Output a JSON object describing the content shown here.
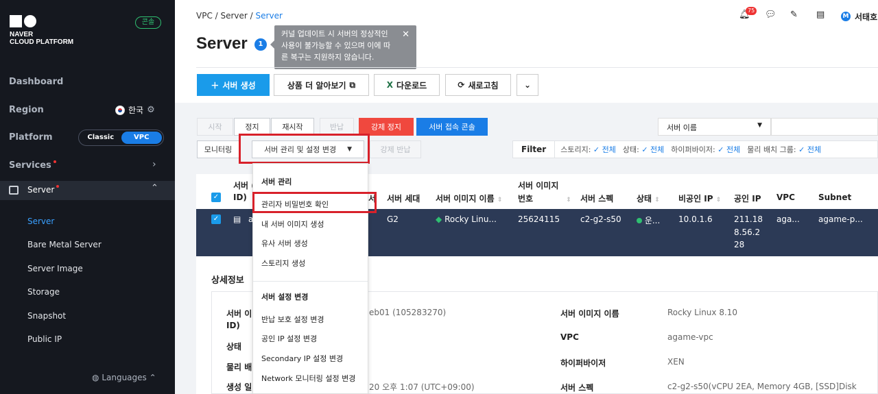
{
  "sidebar": {
    "brand_line1": "NAVER",
    "brand_line2": "CLOUD PLATFORM",
    "console": "콘솔",
    "dashboard": "Dashboard",
    "region_label": "Region",
    "region_value": "한국",
    "platform_label": "Platform",
    "classic": "Classic",
    "vpc": "VPC",
    "services": "Services",
    "server": "Server",
    "sub": [
      "Server",
      "Bare Metal Server",
      "Server Image",
      "Storage",
      "Snapshot",
      "Public IP"
    ],
    "languages": "Languages"
  },
  "header": {
    "breadcrumb": [
      "VPC",
      "Server",
      "Server"
    ],
    "notif_count": "75",
    "user": "서태호",
    "title": "Server",
    "title_badge": "1",
    "tooltip": "커널 업데이트 시 서버의 정상적인 사용이 불가능할 수 있으며 이에 따른 복구는 지원하지 않습니다."
  },
  "toolbar": {
    "create": "서버 생성",
    "more": "상품 더 알아보기",
    "download": "다운로드",
    "refresh": "새로고침"
  },
  "actions": {
    "start": "시작",
    "stop": "정지",
    "restart": "재시작",
    "return": "반납",
    "force_stop": "강제 정지",
    "console_access": "서버 접속 콘솔",
    "monitoring": "모니터링",
    "manage": "서버 관리 및 설정 변경",
    "force_return": "강제 반납"
  },
  "search": {
    "select": "서버 이름"
  },
  "filter": {
    "label": "Filter",
    "items": [
      {
        "k": "스토리지:",
        "v": "전체"
      },
      {
        "k": "상태:",
        "v": "전체"
      },
      {
        "k": "하이퍼바이저:",
        "v": "전체"
      },
      {
        "k": "물리 배치 그룹:",
        "v": "전체"
      }
    ]
  },
  "table": {
    "headers": {
      "name1": "서버 (",
      "name2": "ID)",
      "gen": "서버 세대",
      "img": "서버 이미지 이름",
      "imgno1": "서버 이미지",
      "imgno2": "번호",
      "spec": "서버 스펙",
      "status": "상태",
      "private_ip": "비공인 IP",
      "public_ip": "공인 IP",
      "vpc": "VPC",
      "subnet": "Subnet"
    },
    "row": {
      "name": "a",
      "gen": "G2",
      "img": "Rocky Linu...",
      "imgno": "25624115",
      "spec": "c2-g2-s50",
      "status": "운...",
      "private_ip": "10.0.1.6",
      "public_ip1": "211.18",
      "public_ip2": "8.56.2",
      "public_ip3": "28",
      "vpc": "aga...",
      "subnet": "agame-p..."
    }
  },
  "menu": {
    "h1": "서버 관리",
    "items1": [
      "관리자 비밀번호 확인",
      "내 서버 이미지 생성",
      "유사 서버 생성",
      "스토리지 생성"
    ],
    "h2": "서버 설정 변경",
    "items2": [
      "반납 보호 설정 변경",
      "공인 IP 설정 변경",
      "Secondary IP 설정 변경",
      "Network 모니터링 설정 변경"
    ]
  },
  "detail": {
    "title": "상세정보",
    "l1": "서버 이",
    "l1b": "ID)",
    "v1": "eb01 (105283270)",
    "l2": "상태",
    "l3": "물리 배",
    "l4": "생성 일",
    "v4": "20 오후 1:07 (UTC+09:00)",
    "r1": "서버 이미지 이름",
    "rv1": "Rocky Linux 8.10",
    "r2": "VPC",
    "rv2": "agame-vpc",
    "r3": "하이퍼바이저",
    "rv3": "XEN",
    "r4": "서버 스펙",
    "rv4": "c2-g2-s50(vCPU 2EA, Memory 4GB, [SSD]Disk"
  }
}
